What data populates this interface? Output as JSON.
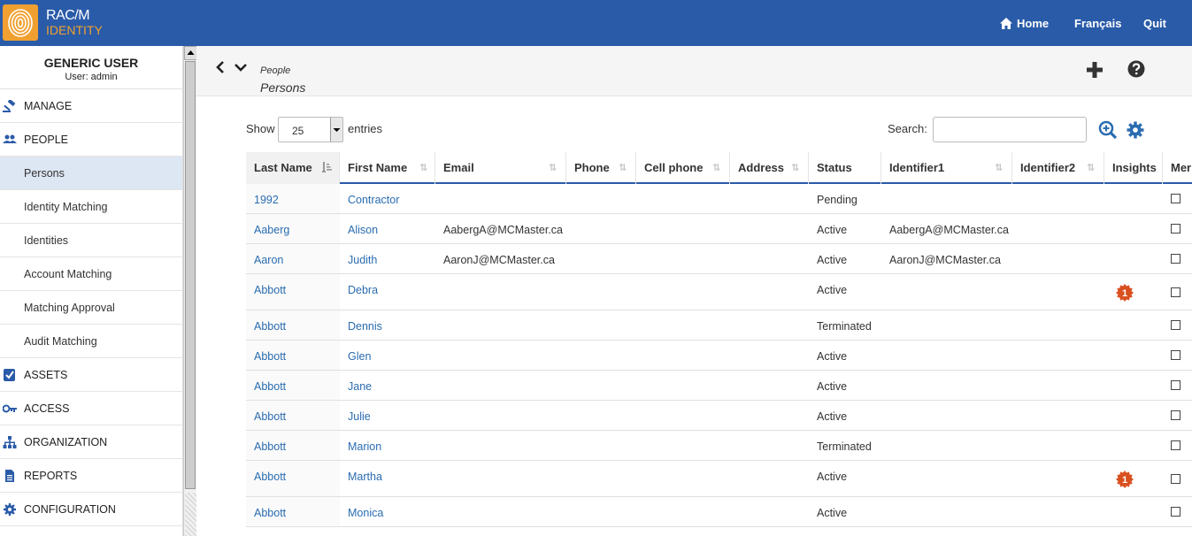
{
  "app": {
    "logo_line1": "RAC/M",
    "logo_line2": "IDENTITY",
    "colors": {
      "topbar": "#2a5ba8",
      "logo": "#f0a030",
      "link": "#2a6cb0",
      "badge": "#d9501f"
    }
  },
  "topnav": {
    "home": "Home",
    "french": "Français",
    "quit": "Quit"
  },
  "sidebar": {
    "user_name": "GENERIC USER",
    "user_sub": "User: admin",
    "items": [
      {
        "label": "MANAGE",
        "icon": "gavel-icon",
        "section": true
      },
      {
        "label": "PEOPLE",
        "icon": "people-icon",
        "section": true
      },
      {
        "label": "Persons",
        "active": true
      },
      {
        "label": "Identity Matching"
      },
      {
        "label": "Identities"
      },
      {
        "label": "Account Matching"
      },
      {
        "label": "Matching Approval"
      },
      {
        "label": "Audit Matching"
      },
      {
        "label": "ASSETS",
        "icon": "checkbox-icon",
        "section": true
      },
      {
        "label": "ACCESS",
        "icon": "key-icon",
        "section": true
      },
      {
        "label": "ORGANIZATION",
        "icon": "org-chart-icon",
        "section": true
      },
      {
        "label": "REPORTS",
        "icon": "document-icon",
        "section": true
      },
      {
        "label": "CONFIGURATION",
        "icon": "gear-icon",
        "section": true
      }
    ]
  },
  "header": {
    "crumb_small": "People",
    "crumb_big": "Persons"
  },
  "controls": {
    "show": "Show",
    "entries_value": "25",
    "entries": "entries",
    "search": "Search:",
    "search_value": ""
  },
  "table": {
    "columns": [
      "Last Name",
      "First Name",
      "Email",
      "Phone",
      "Cell phone",
      "Address",
      "Status",
      "Identifier1",
      "Identifier2",
      "Insights",
      "Mer"
    ],
    "rows": [
      {
        "last": "1992",
        "first": "Contractor",
        "email": "",
        "status": "Pending",
        "id1": "",
        "insights": ""
      },
      {
        "last": "Aaberg",
        "first": "Alison",
        "email": "AabergA@MCMaster.ca",
        "status": "Active",
        "id1": "AabergA@MCMaster.ca",
        "insights": ""
      },
      {
        "last": "Aaron",
        "first": "Judith",
        "email": "AaronJ@MCMaster.ca",
        "status": "Active",
        "id1": "AaronJ@MCMaster.ca",
        "insights": ""
      },
      {
        "last": "Abbott",
        "first": "Debra",
        "email": "",
        "status": "Active",
        "id1": "",
        "insights": "1"
      },
      {
        "last": "Abbott",
        "first": "Dennis",
        "email": "",
        "status": "Terminated",
        "id1": "",
        "insights": ""
      },
      {
        "last": "Abbott",
        "first": "Glen",
        "email": "",
        "status": "Active",
        "id1": "",
        "insights": ""
      },
      {
        "last": "Abbott",
        "first": "Jane",
        "email": "",
        "status": "Active",
        "id1": "",
        "insights": ""
      },
      {
        "last": "Abbott",
        "first": "Julie",
        "email": "",
        "status": "Active",
        "id1": "",
        "insights": ""
      },
      {
        "last": "Abbott",
        "first": "Marion",
        "email": "",
        "status": "Terminated",
        "id1": "",
        "insights": ""
      },
      {
        "last": "Abbott",
        "first": "Martha",
        "email": "",
        "status": "Active",
        "id1": "",
        "insights": "1"
      },
      {
        "last": "Abbott",
        "first": "Monica",
        "email": "",
        "status": "Active",
        "id1": "",
        "insights": ""
      }
    ]
  }
}
